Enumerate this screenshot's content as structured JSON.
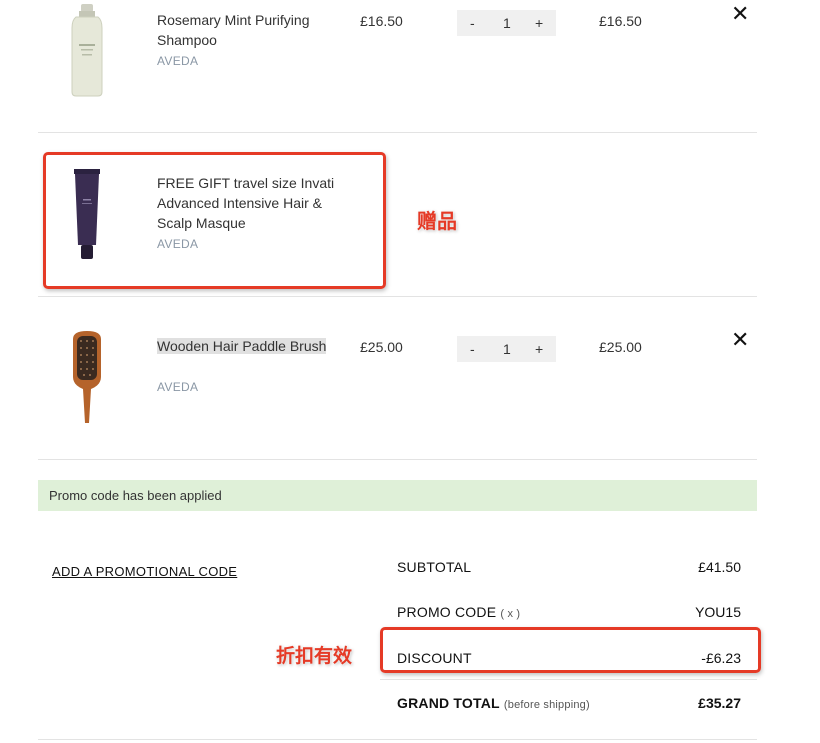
{
  "items": [
    {
      "name": "Rosemary Mint Purifying Shampoo",
      "brand": "AVEDA",
      "price": "£16.50",
      "qty": "1",
      "total": "£16.50",
      "image": "shampoo-bottle"
    },
    {
      "name": "FREE GIFT travel size Invati Advanced Intensive Hair & Scalp Masque",
      "brand": "AVEDA",
      "image": "masque-tube"
    },
    {
      "name": "Wooden Hair Paddle Brush",
      "brand": "AVEDA",
      "price": "£25.00",
      "qty": "1",
      "total": "£25.00",
      "image": "paddle-brush"
    }
  ],
  "qty_controls": {
    "minus": "-",
    "plus": "+"
  },
  "remove_symbol": "✕",
  "annotations": {
    "gift": "赠品",
    "discount": "折扣有效"
  },
  "promo_banner": "Promo code has been applied",
  "add_code_link": "ADD A PROMOTIONAL CODE",
  "summary": {
    "subtotal_label": "SUBTOTAL",
    "subtotal_value": "£41.50",
    "promo_label": "PROMO CODE",
    "promo_remove": "( x )",
    "promo_value": "YOU15",
    "discount_label": "DISCOUNT",
    "discount_value": "-£6.23",
    "grand_label": "GRAND TOTAL",
    "grand_note": "(before shipping)",
    "grand_value": "£35.27"
  },
  "colors": {
    "accent_annotation": "#e53a26",
    "promo_banner_bg": "#dff0d8",
    "brand_text": "#8a97a5"
  }
}
